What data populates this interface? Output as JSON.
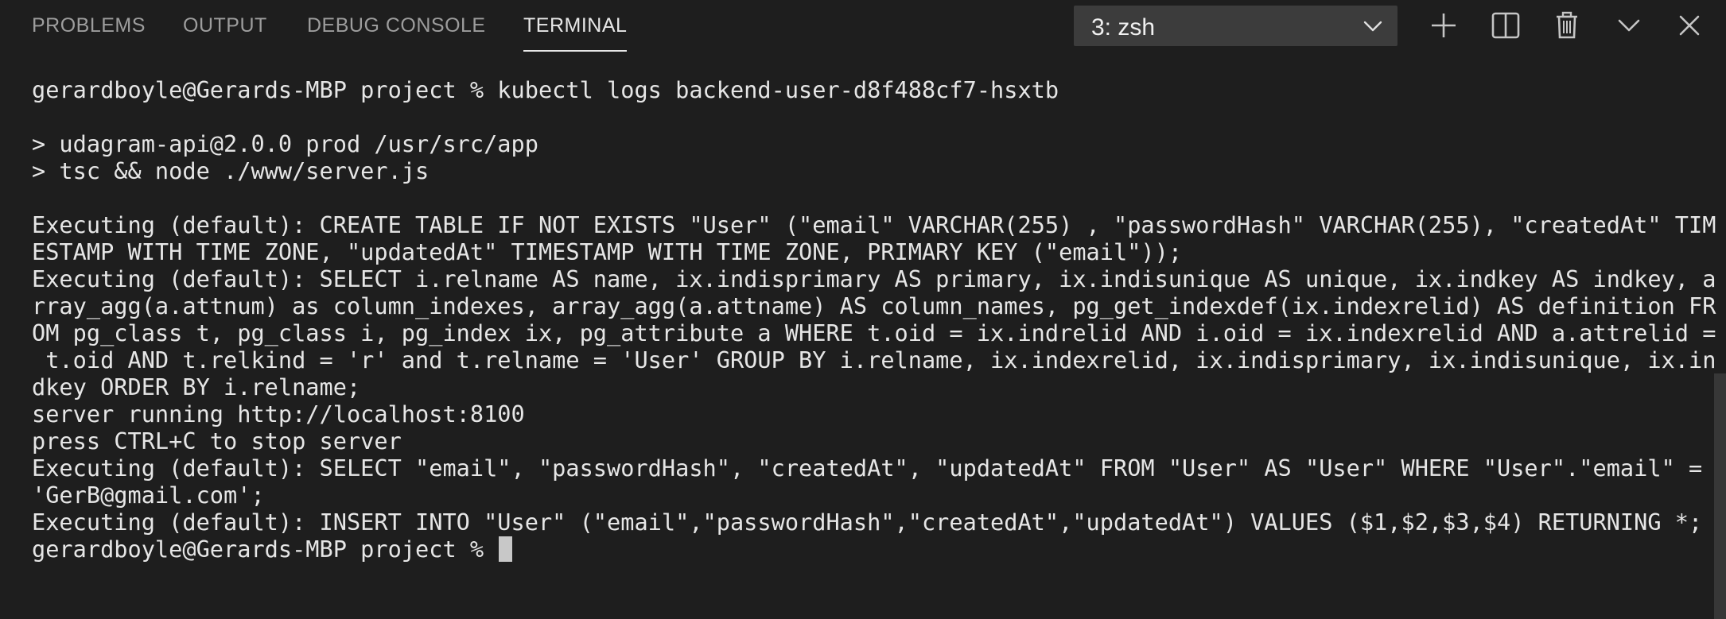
{
  "tabs": {
    "problems": "PROBLEMS",
    "output": "OUTPUT",
    "debug_console": "DEBUG CONSOLE",
    "terminal": "TERMINAL",
    "active": "TERMINAL"
  },
  "terminal_selector": {
    "value": "3: zsh"
  },
  "actions": {
    "icons": [
      "plus-icon",
      "split-icon",
      "trash-icon",
      "chevron-down-icon",
      "close-icon"
    ]
  },
  "colors": {
    "background": "#1e1e1e",
    "text": "#e6e6e6",
    "tab_inactive": "#9d9d9d",
    "tab_active": "#e7e7e7"
  },
  "terminal": {
    "lines": [
      "gerardboyle@Gerards-MBP project % kubectl logs backend-user-d8f488cf7-hsxtb",
      "",
      "> udagram-api@2.0.0 prod /usr/src/app",
      "> tsc && node ./www/server.js",
      "",
      "Executing (default): CREATE TABLE IF NOT EXISTS \"User\" (\"email\" VARCHAR(255) , \"passwordHash\" VARCHAR(255), \"createdAt\" TIM",
      "ESTAMP WITH TIME ZONE, \"updatedAt\" TIMESTAMP WITH TIME ZONE, PRIMARY KEY (\"email\"));",
      "Executing (default): SELECT i.relname AS name, ix.indisprimary AS primary, ix.indisunique AS unique, ix.indkey AS indkey, a",
      "rray_agg(a.attnum) as column_indexes, array_agg(a.attname) AS column_names, pg_get_indexdef(ix.indexrelid) AS definition FR",
      "OM pg_class t, pg_class i, pg_index ix, pg_attribute a WHERE t.oid = ix.indrelid AND i.oid = ix.indexrelid AND a.attrelid =",
      " t.oid AND t.relkind = 'r' and t.relname = 'User' GROUP BY i.relname, ix.indexrelid, ix.indisprimary, ix.indisunique, ix.in",
      "dkey ORDER BY i.relname;",
      "server running http://localhost:8100",
      "press CTRL+C to stop server",
      "Executing (default): SELECT \"email\", \"passwordHash\", \"createdAt\", \"updatedAt\" FROM \"User\" AS \"User\" WHERE \"User\".\"email\" =",
      "'GerB@gmail.com';",
      "Executing (default): INSERT INTO \"User\" (\"email\",\"passwordHash\",\"createdAt\",\"updatedAt\") VALUES ($1,$2,$3,$4) RETURNING *;"
    ],
    "prompt": "gerardboyle@Gerards-MBP project % "
  }
}
